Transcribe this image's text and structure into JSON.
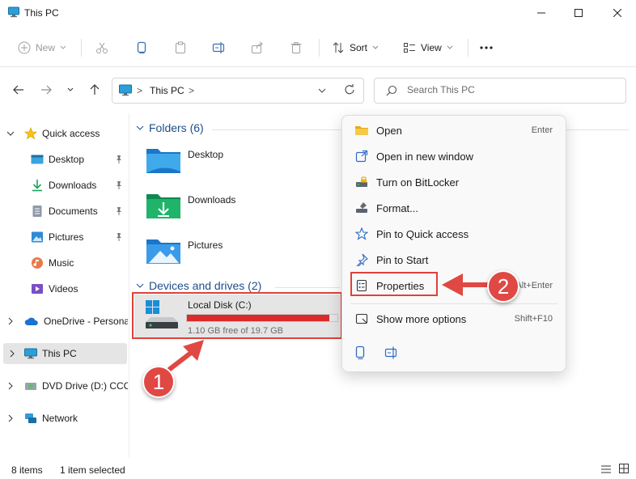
{
  "window": {
    "title": "This PC",
    "icon": "monitor-icon",
    "controls": [
      "minimize-icon",
      "maximize-icon",
      "close-icon"
    ]
  },
  "toolbar": {
    "new_label": "New",
    "sort_label": "Sort",
    "view_label": "View",
    "more_icon": "ellipsis-icon"
  },
  "address": {
    "location": "This PC",
    "separator": ">"
  },
  "search": {
    "placeholder": "Search This PC",
    "value": ""
  },
  "sidebar": {
    "quick_access": "Quick access",
    "items": [
      {
        "label": "Desktop",
        "pinned": true
      },
      {
        "label": "Downloads",
        "pinned": true
      },
      {
        "label": "Documents",
        "pinned": true
      },
      {
        "label": "Pictures",
        "pinned": true
      },
      {
        "label": "Music",
        "pinned": false
      },
      {
        "label": "Videos",
        "pinned": false
      }
    ],
    "onedrive": "OneDrive - Personal",
    "this_pc": "This PC",
    "dvd": "DVD Drive (D:) CCC",
    "network": "Network"
  },
  "main": {
    "folders_header": "Folders (6)",
    "folders": [
      "Desktop",
      "Downloads",
      "Pictures"
    ],
    "drives_header": "Devices and drives (2)",
    "drive": {
      "name": "Local Disk (C:)",
      "free_text": "1.10 GB free of 19.7 GB",
      "used_fraction": 0.944,
      "bar_color": "#da2a2a"
    }
  },
  "context_menu": {
    "items": [
      {
        "label": "Open",
        "shortcut": "Enter",
        "icon": "folder-open-icon"
      },
      {
        "label": "Open in new window",
        "shortcut": "",
        "icon": "new-window-icon"
      },
      {
        "label": "Turn on BitLocker",
        "shortcut": "",
        "icon": "bitlocker-icon"
      },
      {
        "label": "Format...",
        "shortcut": "",
        "icon": "format-icon"
      },
      {
        "label": "Pin to Quick access",
        "shortcut": "",
        "icon": "star-icon"
      },
      {
        "label": "Pin to Start",
        "shortcut": "",
        "icon": "pin-icon"
      },
      {
        "label": "Properties",
        "shortcut": "Alt+Enter",
        "icon": "properties-icon"
      },
      {
        "label": "Show more options",
        "shortcut": "Shift+F10",
        "icon": "more-options-icon"
      }
    ],
    "bottom_icons": [
      "copy-icon",
      "rename-icon"
    ]
  },
  "callouts": {
    "step1": "1",
    "step2": "2",
    "color": "#e04844"
  },
  "statusbar": {
    "items_count": "8 items",
    "selected": "1 item selected"
  }
}
